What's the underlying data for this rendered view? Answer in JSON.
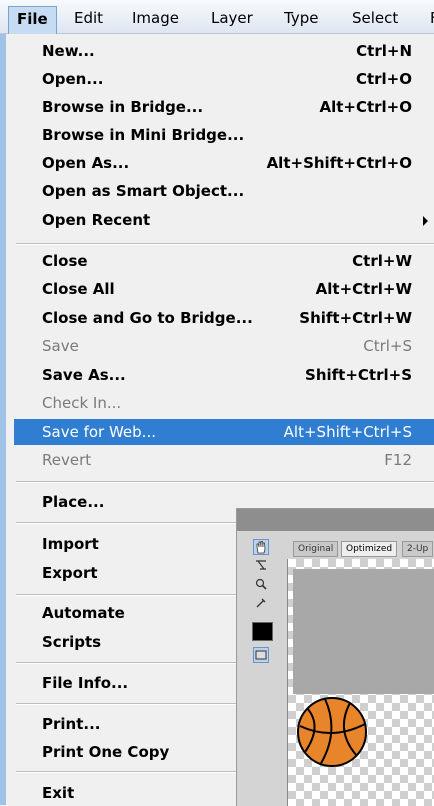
{
  "menubar": {
    "items": [
      "File",
      "Edit",
      "Image",
      "Layer",
      "Type",
      "Select",
      "F"
    ]
  },
  "menu": {
    "groups": [
      [
        {
          "label": "New...",
          "shortcut": "Ctrl+N"
        },
        {
          "label": "Open...",
          "shortcut": "Ctrl+O"
        },
        {
          "label": "Browse in Bridge...",
          "shortcut": "Alt+Ctrl+O"
        },
        {
          "label": "Browse in Mini Bridge...",
          "shortcut": ""
        },
        {
          "label": "Open As...",
          "shortcut": "Alt+Shift+Ctrl+O"
        },
        {
          "label": "Open as Smart Object...",
          "shortcut": ""
        },
        {
          "label": "Open Recent",
          "shortcut": "",
          "submenu": true
        }
      ],
      [
        {
          "label": "Close",
          "shortcut": "Ctrl+W"
        },
        {
          "label": "Close All",
          "shortcut": "Alt+Ctrl+W"
        },
        {
          "label": "Close and Go to Bridge...",
          "shortcut": "Shift+Ctrl+W"
        },
        {
          "label": "Save",
          "shortcut": "Ctrl+S",
          "disabled": true
        },
        {
          "label": "Save As...",
          "shortcut": "Shift+Ctrl+S"
        },
        {
          "label": "Check In...",
          "shortcut": "",
          "disabled": true
        },
        {
          "label": "Save for Web...",
          "shortcut": "Alt+Shift+Ctrl+S",
          "highlighted": true
        },
        {
          "label": "Revert",
          "shortcut": "F12",
          "disabled": true
        }
      ],
      [
        {
          "label": "Place...",
          "shortcut": ""
        }
      ],
      [
        {
          "label": "Import",
          "shortcut": ""
        },
        {
          "label": "Export",
          "shortcut": ""
        }
      ],
      [
        {
          "label": "Automate",
          "shortcut": ""
        },
        {
          "label": "Scripts",
          "shortcut": ""
        }
      ],
      [
        {
          "label": "File Info...",
          "shortcut": ""
        }
      ],
      [
        {
          "label": "Print...",
          "shortcut": ""
        },
        {
          "label": "Print One Copy",
          "shortcut": ""
        }
      ],
      [
        {
          "label": "Exit",
          "shortcut": ""
        }
      ]
    ]
  },
  "save_for_web_window": {
    "tabs": [
      "Original",
      "Optimized",
      "2-Up"
    ],
    "active_tab": "Optimized",
    "tools": [
      "hand-tool-icon",
      "slice-select-tool-icon",
      "zoom-tool-icon",
      "eyedropper-tool-icon"
    ]
  },
  "colors": {
    "highlight": "#2f7ed1",
    "menu_background": "#f0f0f0",
    "disabled_text": "#7a7a7a",
    "basketball": "#e8842a"
  }
}
